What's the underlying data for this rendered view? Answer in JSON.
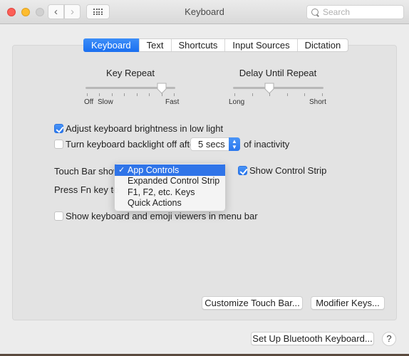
{
  "window": {
    "title": "Keyboard",
    "search_placeholder": "Search"
  },
  "tabs": [
    {
      "label": "Keyboard",
      "active": true
    },
    {
      "label": "Text",
      "active": false
    },
    {
      "label": "Shortcuts",
      "active": false
    },
    {
      "label": "Input Sources",
      "active": false
    },
    {
      "label": "Dictation",
      "active": false
    }
  ],
  "key_repeat": {
    "label": "Key Repeat",
    "min_label": "Off",
    "slow_label": "Slow",
    "max_label": "Fast",
    "tick_count": 8,
    "value_index": 6
  },
  "delay_until_repeat": {
    "label": "Delay Until Repeat",
    "min_label": "Long",
    "max_label": "Short",
    "tick_count": 6,
    "value_index": 2
  },
  "options": {
    "adjust_brightness": {
      "label": "Adjust keyboard brightness in low light",
      "checked": true
    },
    "backlight_off": {
      "label": "Turn keyboard backlight off after",
      "checked": false,
      "value": "5 secs",
      "suffix": "of inactivity"
    },
    "touch_bar_shows_label": "Touch Bar shows",
    "show_control_strip": {
      "label": "Show Control Strip",
      "checked": true
    },
    "press_fn_label": "Press Fn key to",
    "show_viewers": {
      "label": "Show keyboard and emoji viewers in menu bar",
      "checked": false
    }
  },
  "touch_bar_menu": {
    "selected": "App Controls",
    "items": [
      "App Controls",
      "Expanded Control Strip",
      "F1, F2, etc. Keys",
      "Quick Actions"
    ]
  },
  "buttons": {
    "customize_touch_bar": "Customize Touch Bar...",
    "modifier_keys": "Modifier Keys...",
    "setup_bluetooth": "Set Up Bluetooth Keyboard...",
    "help": "?"
  },
  "icons": {
    "back": "‹",
    "forward": "›",
    "menu_check": "✓",
    "stepper": "⌃⌄"
  }
}
